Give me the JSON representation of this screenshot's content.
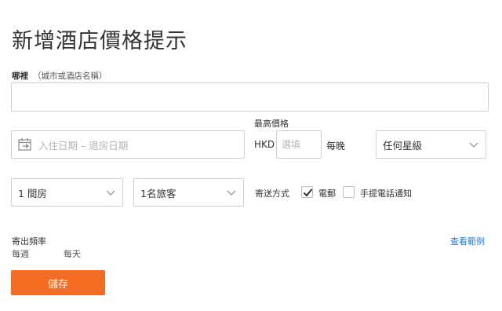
{
  "page": {
    "title": "新增酒店價格提示"
  },
  "where": {
    "label": "哪裡",
    "hint": "（城市或酒店名稱）",
    "value": ""
  },
  "dates": {
    "placeholder": "入住日期 – 退房日期"
  },
  "max_price": {
    "label": "最高價格",
    "currency": "HKD",
    "placeholder": "選填",
    "per_night": "每晚"
  },
  "stars": {
    "selected": "任何星級"
  },
  "rooms": {
    "selected": "1 間房"
  },
  "guests": {
    "selected": "1名旅客"
  },
  "send": {
    "label": "寄送方式",
    "email": {
      "label": "電郵",
      "checked": true
    },
    "sms": {
      "label": "手提電話通知",
      "checked": false
    }
  },
  "frequency": {
    "label": "寄出頻率",
    "options": [
      "每週",
      "每天"
    ]
  },
  "example_link": "查看範例",
  "save_button": "儲存",
  "colors": {
    "accent": "#f36c21",
    "link": "#1a7bd8",
    "border": "#cfcfcf"
  }
}
